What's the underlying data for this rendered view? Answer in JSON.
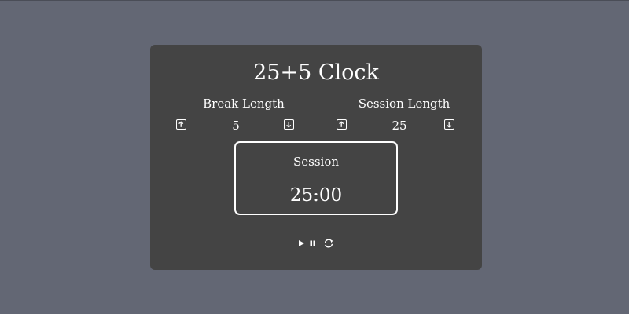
{
  "app": {
    "title": "25+5 Clock"
  },
  "break": {
    "label": "Break Length",
    "value": "5",
    "increment_icon": "arrow-up-square-icon",
    "decrement_icon": "arrow-down-square-icon"
  },
  "session": {
    "label": "Session Length",
    "value": "25",
    "increment_icon": "arrow-up-square-icon",
    "decrement_icon": "arrow-down-square-icon"
  },
  "timer": {
    "label": "Session",
    "time_left": "25:00"
  },
  "playback": {
    "play_icon": "play-icon",
    "pause_icon": "pause-icon",
    "reset_icon": "refresh-icon"
  },
  "colors": {
    "page_background": "#636774",
    "card_background": "#444444",
    "text": "#ffffff"
  }
}
